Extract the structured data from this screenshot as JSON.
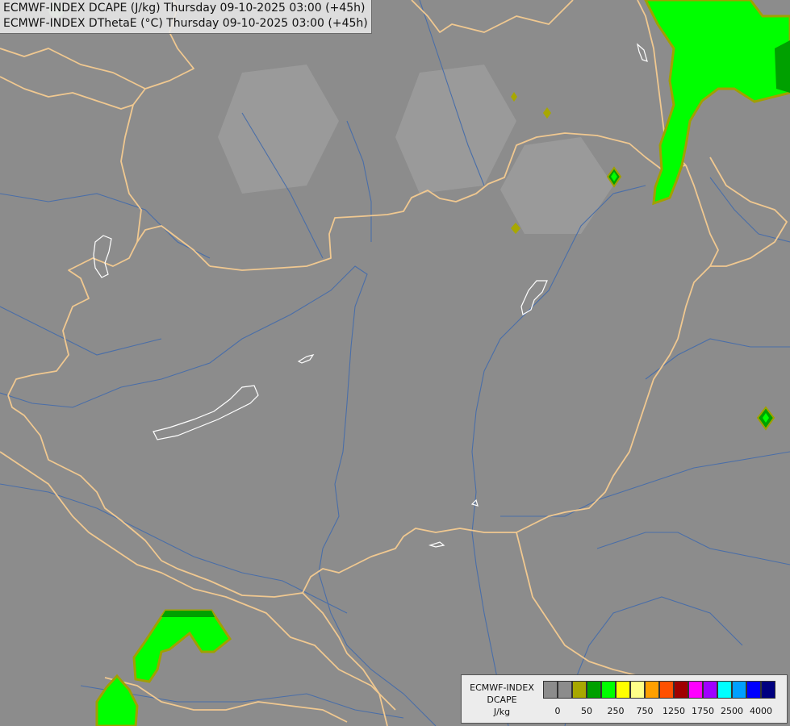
{
  "header": {
    "line1": "ECMWF-INDEX DCAPE (J/kg) Thursday 09-10-2025 03:00 (+45h)",
    "line2": "ECMWF-INDEX DThetaE (°C) Thursday 09-10-2025 03:00 (+45h)"
  },
  "map": {
    "background_color": "#8c8c8c",
    "border_color": "#f0c890",
    "river_color": "#4a6ea8",
    "lake_color": "#ffffff",
    "dcape_fill_color": "#00ff00",
    "dcape_edge_color": "#a0a000"
  },
  "legend": {
    "title_line1": "ECMWF-INDEX",
    "title_line2": "DCAPE",
    "title_line3": "J/kg",
    "colors": [
      "#8c8c8c",
      "#8c8c8c",
      "#a8a800",
      "#00a000",
      "#00ff00",
      "#ffff00",
      "#ffff88",
      "#ffa000",
      "#ff5000",
      "#a00000",
      "#ff00ff",
      "#a000ff",
      "#00ffff",
      "#00a0ff",
      "#0000ff",
      "#000080"
    ],
    "labels": [
      "0",
      "50",
      "250",
      "750",
      "1250",
      "1750",
      "2500",
      "4000"
    ]
  }
}
